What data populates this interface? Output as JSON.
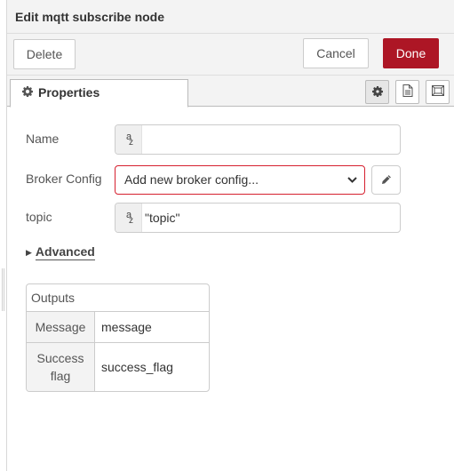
{
  "tray": {
    "title": "Edit mqtt subscribe node",
    "toolbar": {
      "delete_label": "Delete",
      "cancel_label": "Cancel",
      "done_label": "Done"
    }
  },
  "tabs": {
    "properties_label": "Properties",
    "properties_icon": "gear-icon",
    "side_buttons": [
      "gear-icon",
      "document-icon",
      "appearance-frame-icon"
    ]
  },
  "form": {
    "name": {
      "label": "Name",
      "value": "",
      "type_icon": "string-type-icon"
    },
    "broker": {
      "label": "Broker Config",
      "selected": "Add new broker config...",
      "edit_icon": "pencil-icon"
    },
    "topic": {
      "label": "topic",
      "value": "\"topic\"",
      "type_icon": "string-type-icon"
    },
    "advanced_label": "Advanced"
  },
  "outputs": {
    "title": "Outputs",
    "rows": [
      {
        "label": "Message",
        "value": "message"
      },
      {
        "label": "Success flag",
        "value": "success_flag"
      }
    ]
  },
  "colors": {
    "accent": "#ad1625",
    "error_border": "#d6202f",
    "panel_bg": "#f3f3f3",
    "border": "#cccccc"
  }
}
